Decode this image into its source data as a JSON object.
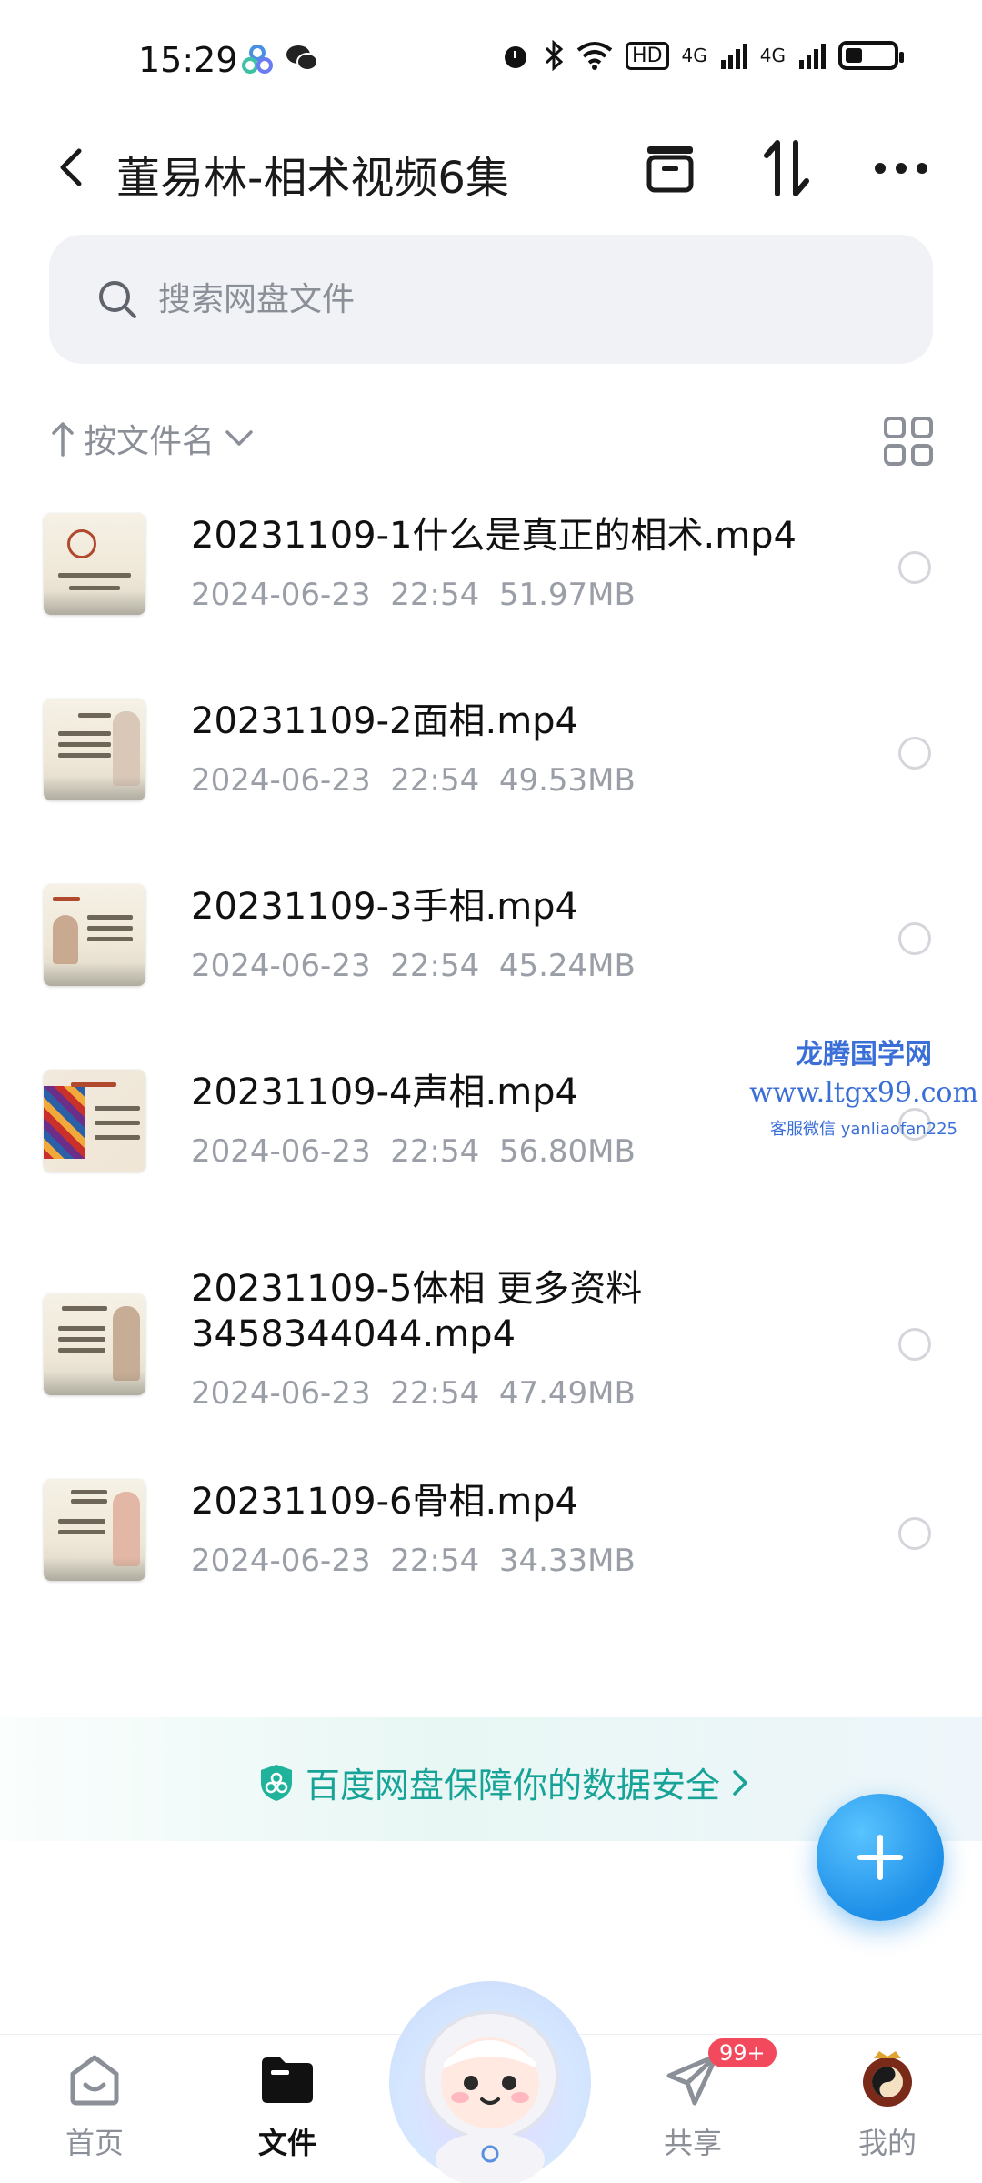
{
  "status_bar": {
    "time": "15:29",
    "network_1": "4G",
    "network_2": "4G",
    "hd_label": "HD",
    "battery_level": 0.35
  },
  "header": {
    "title": "董易林-相术视频6集"
  },
  "search": {
    "placeholder": "搜索网盘文件",
    "value": ""
  },
  "sort": {
    "label": "按文件名"
  },
  "files": [
    {
      "name": "20231109-1什么是真正的相术.mp4",
      "date": "2024-06-23",
      "time": "22:54",
      "size": "51.97MB"
    },
    {
      "name": "20231109-2面相.mp4",
      "date": "2024-06-23",
      "time": "22:54",
      "size": "49.53MB"
    },
    {
      "name": "20231109-3手相.mp4",
      "date": "2024-06-23",
      "time": "22:54",
      "size": "45.24MB"
    },
    {
      "name": "20231109-4声相.mp4",
      "date": "2024-06-23",
      "time": "22:54",
      "size": "56.80MB"
    },
    {
      "name": "20231109-5体相 更多资料3458344044.mp4",
      "date": "2024-06-23",
      "time": "22:54",
      "size": "47.49MB"
    },
    {
      "name": "20231109-6骨相.mp4",
      "date": "2024-06-23",
      "time": "22:54",
      "size": "34.33MB"
    }
  ],
  "watermark": {
    "site_name": "龙腾国学网",
    "url": "www.ltgx99.com",
    "contact": "客服微信 yanliaofan225"
  },
  "banner": {
    "text": "百度网盘保障你的数据安全"
  },
  "nav": {
    "home": "首页",
    "files": "文件",
    "share": "共享",
    "share_badge": "99+",
    "mine": "我的"
  },
  "colors": {
    "accent": "#1e8fe8",
    "banner_text": "#17a398",
    "badge": "#f24a5c"
  }
}
